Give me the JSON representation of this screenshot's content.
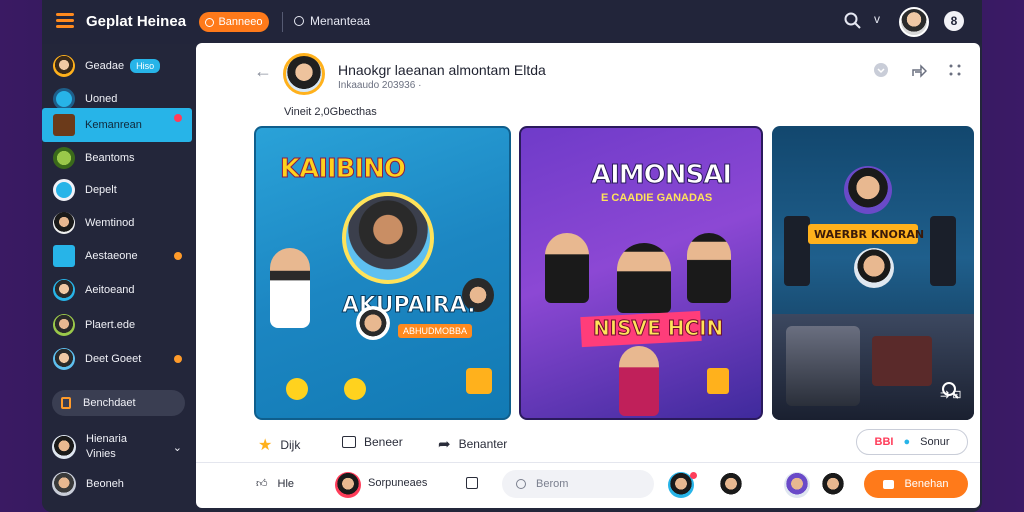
{
  "app": {
    "title": "Geplat Heinea"
  },
  "topbar": {
    "orange_pill": "Banneeo",
    "link": "Menanteaa",
    "chevron": "v",
    "bell": "8"
  },
  "sidebar": {
    "profile": {
      "label": "Geadae",
      "tag": "Hiso"
    },
    "items": [
      {
        "label": "Uoned"
      },
      {
        "label": "Kemanrean"
      },
      {
        "label": "Beantoms"
      },
      {
        "label": "Depelt"
      },
      {
        "label": "Wemtinod"
      },
      {
        "label": "Aestaeone"
      },
      {
        "label": "Aeitoeand"
      },
      {
        "label": "Plaert.ede"
      },
      {
        "label": "Deet Goeet"
      }
    ],
    "button_label": "Benchdaet",
    "users": [
      {
        "name": "Hienaria",
        "sub": "Vinies"
      },
      {
        "name": "Beoneh"
      }
    ]
  },
  "post": {
    "author": "Hnaokgr laeanan almontam Eltda",
    "meta": "Inkaaudo 203936 ·",
    "caption": "Vineit 2,0Gbecthas",
    "images": [
      {
        "title": "KAIIBINO",
        "name": "AKUPAIRA.",
        "badge": "ABHUDMOBBA"
      },
      {
        "title": "AIMONSAI",
        "sub": "E CAADIE GANADAS",
        "name": "NISVE HCIN"
      },
      {
        "card": "WAERBR KNORAN",
        "icons": "⇉ ⊡"
      }
    ],
    "actions": {
      "star": "Dijk",
      "comment": "Beneer",
      "share": "Benanter"
    },
    "pill": {
      "left": "BBI",
      "right": "Sonur"
    }
  },
  "bottom": {
    "like": "Hle",
    "user": "Sorpuneaes",
    "search_placeholder": "Berom",
    "button": "Benehan"
  }
}
